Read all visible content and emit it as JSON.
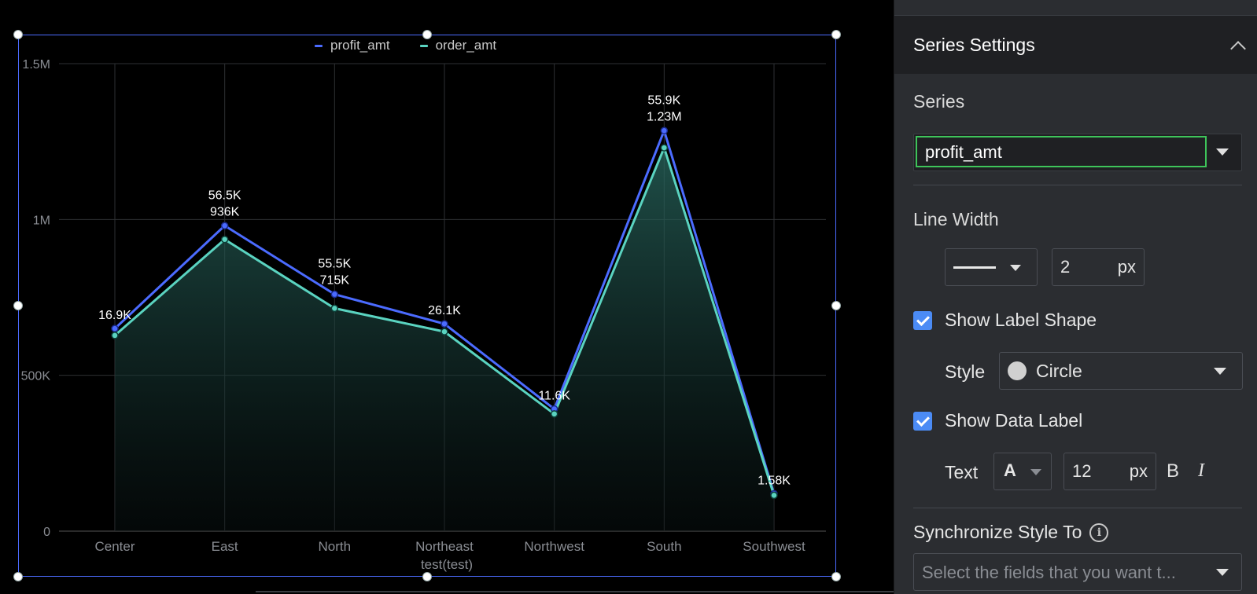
{
  "chart_data": {
    "type": "line",
    "categories": [
      "Center",
      "East",
      "North",
      "Northeast",
      "Northwest",
      "South",
      "Southwest"
    ],
    "xlabel": "test(test)",
    "ylabel": "",
    "y_ticks": [
      "1.5M",
      "1M",
      "500K",
      "0"
    ],
    "ylim": [
      0,
      1500000
    ],
    "grid": true,
    "legend_placement": "top",
    "series": [
      {
        "name": "profit_amt",
        "color": "#4b6bff",
        "values": [
          650000,
          980000,
          760000,
          665000,
          392000,
          1285000,
          120000
        ],
        "labels": [
          "16.9K",
          "56.5K",
          "55.5K",
          "26.1K",
          "11.6K",
          "55.9K",
          "1.58K"
        ]
      },
      {
        "name": "order_amt",
        "color": "#5ad3c0",
        "values": [
          628000,
          936000,
          715000,
          640000,
          376000,
          1230000,
          115000
        ],
        "labels": [
          "",
          "936K",
          "715K",
          "",
          "",
          "1.23M",
          ""
        ]
      }
    ]
  },
  "panel": {
    "title": "Series Settings",
    "series_label": "Series",
    "series_value": "profit_amt",
    "line_width_label": "Line Width",
    "line_width_value": "2",
    "unit_px": "px",
    "show_label_shape": "Show Label Shape",
    "style_label": "Style",
    "style_value": "Circle",
    "show_data_label": "Show Data Label",
    "text_label": "Text",
    "font_glyph": "A",
    "font_size_value": "12",
    "bold": "B",
    "italic": "I",
    "sync_label": "Synchronize Style To",
    "info_glyph": "i",
    "sync_placeholder": "Select the fields that you want t..."
  },
  "icons": [
    "chevron-up-icon",
    "chevron-down-icon",
    "checkbox-checked-icon",
    "info-icon",
    "circle-shape-icon"
  ]
}
